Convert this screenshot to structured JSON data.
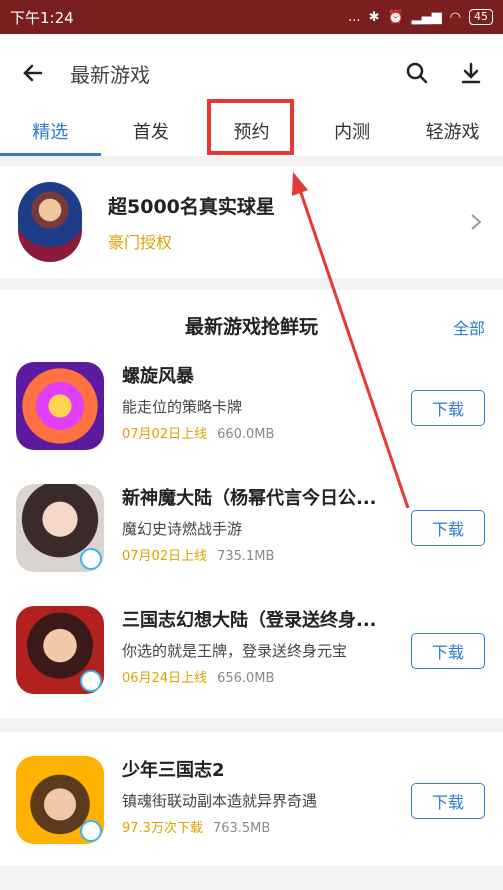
{
  "status_bar": {
    "time": "下午1:24",
    "icons_text": "...",
    "battery": "45"
  },
  "header": {
    "title": "最新游戏"
  },
  "tabs": [
    {
      "label": "精选"
    },
    {
      "label": "首发"
    },
    {
      "label": "预约"
    },
    {
      "label": "内测"
    },
    {
      "label": "轻游戏"
    }
  ],
  "promo": {
    "title": "超5000名真实球星",
    "subtitle": "豪门授权"
  },
  "section": {
    "title": "最新游戏抢鲜玩",
    "more": "全部"
  },
  "games": [
    {
      "name": "螺旋风暴",
      "desc": "能走位的策略卡牌",
      "date": "07月02日上线",
      "size": "660.0MB",
      "button": "下载"
    },
    {
      "name": "新神魔大陆（杨幂代言今日公...",
      "desc": "魔幻史诗燃战手游",
      "date": "07月02日上线",
      "size": "735.1MB",
      "button": "下载"
    },
    {
      "name": "三国志幻想大陆（登录送终身...",
      "desc": "你选的就是王牌，登录送终身元宝",
      "date": "06月24日上线",
      "size": "656.0MB",
      "button": "下载"
    },
    {
      "name": "少年三国志2",
      "desc": "镇魂街联动副本造就异界奇遇",
      "date": "97.3万次下载",
      "size": "763.5MB",
      "button": "下载"
    }
  ],
  "colors": {
    "accent": "#2e7bd6",
    "status_bar": "#7a1f1f",
    "highlight": "#e53935",
    "date": "#e0a100"
  }
}
